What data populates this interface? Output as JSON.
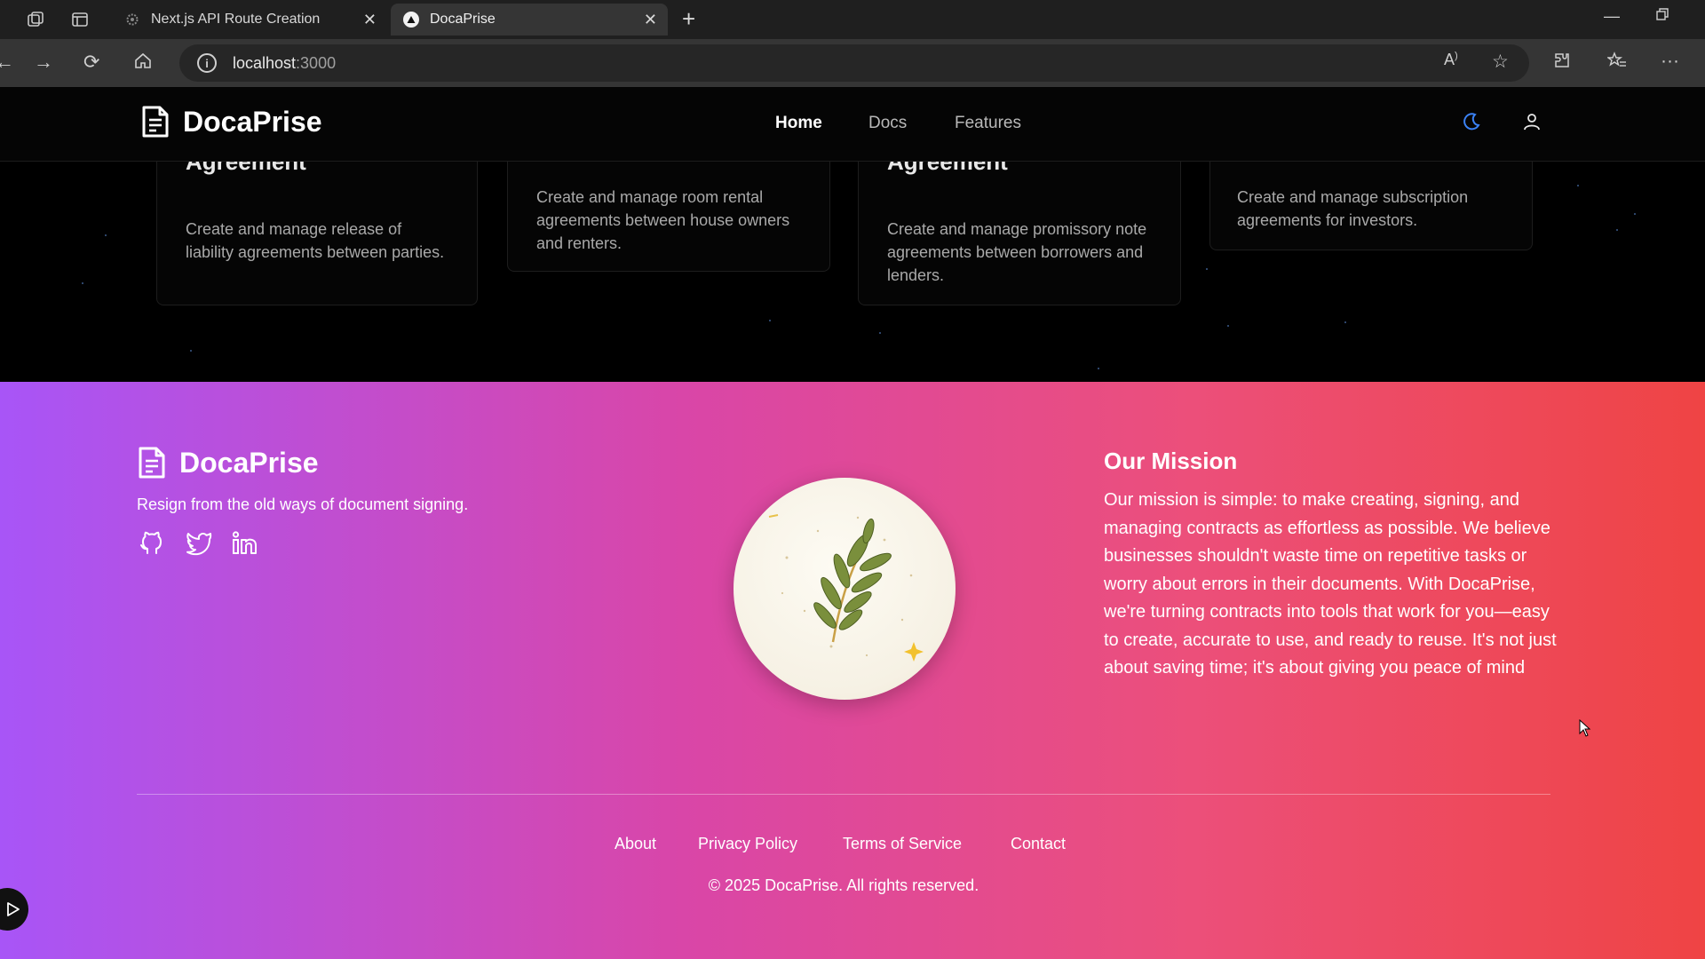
{
  "browser": {
    "tabs": [
      {
        "title": "Next.js API Route Creation",
        "active": false
      },
      {
        "title": "DocaPrise",
        "active": true
      }
    ],
    "url_host": "localhost",
    "url_port": ":3000"
  },
  "header": {
    "brand": "DocaPrise",
    "nav": [
      "Home",
      "Docs",
      "Features"
    ],
    "active_nav": "Home"
  },
  "cards": [
    {
      "title": "Agreement",
      "description": "Create and manage release of liability agreements between parties."
    },
    {
      "title": "",
      "description": "Create and manage room rental agreements between house owners and renters."
    },
    {
      "title": "Agreement",
      "description": "Create and manage promissory note agreements between borrowers and lenders."
    },
    {
      "title": "",
      "description": "Create and manage subscription agreements for investors."
    }
  ],
  "footer": {
    "brand": "DocaPrise",
    "tagline": "Resign from the old ways of document signing.",
    "social_icons": [
      "github-icon",
      "twitter-icon",
      "linkedin-icon"
    ],
    "mission_title": "Our Mission",
    "mission_text": "Our mission is simple: to make creating, signing, and managing contracts as effortless as possible. We believe businesses shouldn't waste time on repetitive tasks or worry about errors in their documents. With DocaPrise, we're turning contracts into tools that work for you—easy to create, accurate to use, and ready to reuse. It's not just about saving time; it's about giving you peace of mind",
    "links": [
      "About",
      "Privacy Policy",
      "Terms of Service",
      "Contact"
    ],
    "copyright": "© 2025 DocaPrise. All rights reserved."
  },
  "colors": {
    "gradient_start": "#a855f7",
    "gradient_mid": "#d946a8",
    "gradient_end": "#ef4444",
    "page_bg": "#000000"
  }
}
